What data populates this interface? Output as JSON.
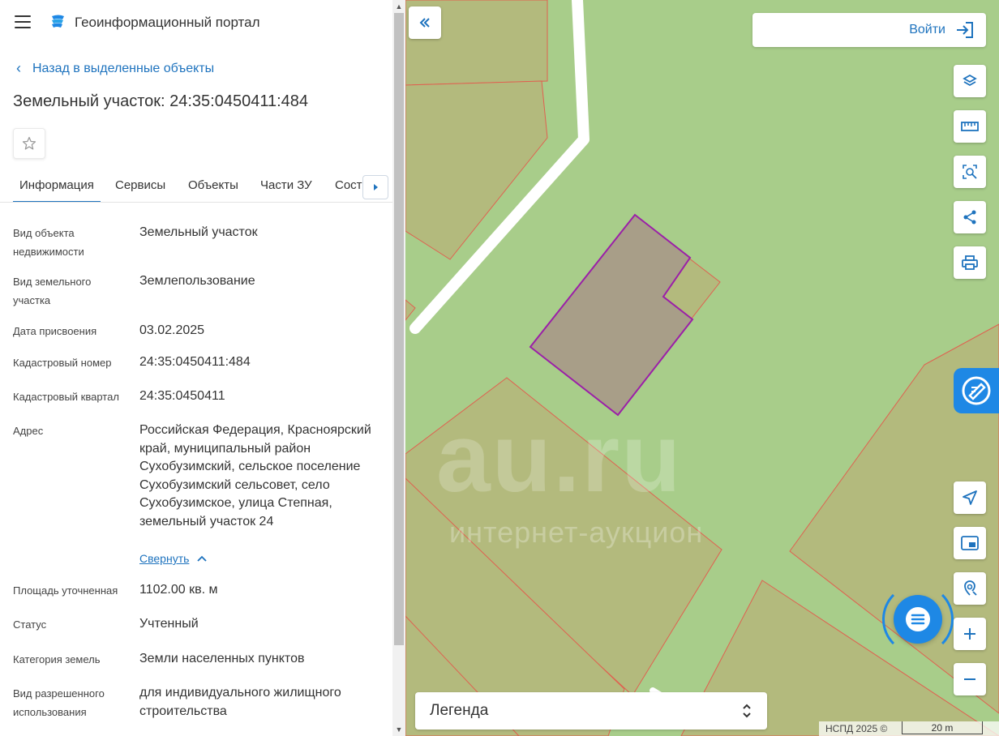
{
  "header": {
    "portal_title": "Геоинформационный портал"
  },
  "nav": {
    "back_label": "Назад в выделенные объекты"
  },
  "object": {
    "title": "Земельный участок: 24:35:0450411:484"
  },
  "tabs": [
    {
      "label": "Информация",
      "active": true
    },
    {
      "label": "Сервисы",
      "active": false
    },
    {
      "label": "Объекты",
      "active": false
    },
    {
      "label": "Части ЗУ",
      "active": false
    },
    {
      "label": "Соста",
      "active": false
    }
  ],
  "attributes": [
    {
      "label": "Вид объекта недвижимости",
      "value": "Земельный участок"
    },
    {
      "label": "Вид земельного участка",
      "value": "Землепользование"
    },
    {
      "label": "Дата присвоения",
      "value": "03.02.2025"
    },
    {
      "label": "Кадастровый номер",
      "value": "24:35:0450411:484"
    },
    {
      "label": "Кадастровый квартал",
      "value": "24:35:0450411"
    },
    {
      "label": "Адрес",
      "value": "Российская Федерация, Красноярский край, муниципальный район Сухобузимский, сельское поселение Сухобузимский сельсовет, село Сухобузимское, улица Степная, земельный участок 24"
    },
    {
      "label": "Площадь уточненная",
      "value": "1102.00 кв. м"
    },
    {
      "label": "Статус",
      "value": "Учтенный"
    },
    {
      "label": "Категория земель",
      "value": "Земли населенных пунктов"
    },
    {
      "label": "Вид разрешенного использования",
      "value": "для индивидуального жилищного строительства"
    }
  ],
  "address_toggle": "Свернуть",
  "map": {
    "login_label": "Войти",
    "legend_label": "Легенда",
    "watermark_main": "au.ru",
    "watermark_sub": "интернет-аукцион",
    "attribution": "НСПД 2025 ©",
    "scale_label": "20 m",
    "colors": {
      "map_bg": "#a8cd8a",
      "parcel_fill": "#b3ba7d",
      "parcel_stroke": "#e06050",
      "selected_fill": "#a89e88",
      "selected_stroke": "#9b1fa8",
      "accent": "#1e73be"
    }
  },
  "icons": [
    "hamburger-icon",
    "portal-logo-icon",
    "chevron-left-icon",
    "star-icon",
    "chevron-right-icon",
    "double-chevron-left-icon",
    "login-icon",
    "layers-icon",
    "ruler-icon",
    "select-area-icon",
    "share-icon",
    "print-icon",
    "feedback-icon",
    "navigate-icon",
    "picture-in-picture-icon",
    "location-search-icon",
    "plus-icon",
    "minus-icon",
    "chat-icon",
    "up-down-chevron-icon"
  ]
}
